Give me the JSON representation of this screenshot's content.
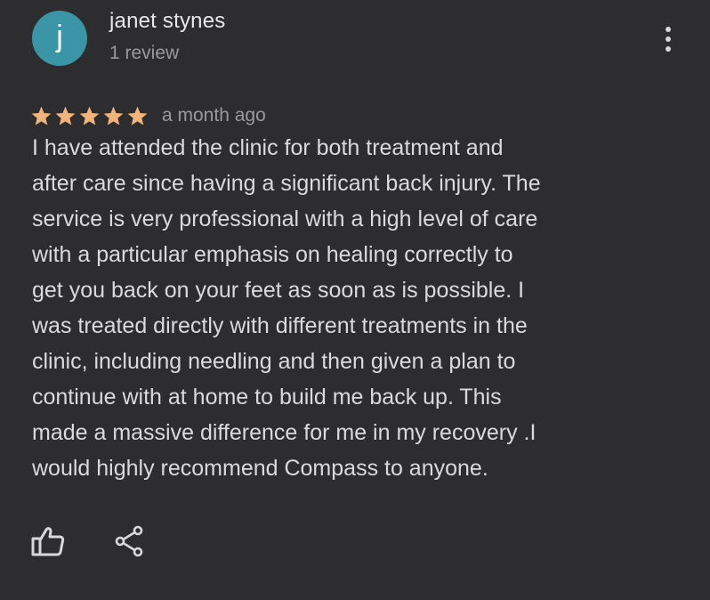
{
  "review": {
    "author": {
      "initial": "j",
      "name": "janet stynes",
      "review_count": "1 review",
      "avatar_color": "#3a95a6"
    },
    "rating": {
      "stars": 5,
      "max": 5,
      "star_color": "#f0b37a"
    },
    "date": "a month ago",
    "text": "I have attended the clinic for both treatment and\nafter care since having a significant back injury. The\nservice is very professional with  a high level of care\nwith a particular emphasis on healing correctly to\nget you back on your feet as soon as is possible. I\nwas treated directly with different treatments in the\nclinic, including needling and then given a plan to\ncontinue with at home to build me back up. This\nmade a massive difference for me in my recovery .I\nwould highly recommend Compass to anyone."
  },
  "actions": {
    "more_icon": "more-vertical-icon",
    "like_icon": "thumbs-up-icon",
    "share_icon": "share-icon"
  },
  "theme": {
    "background": "#2d2d30",
    "text": "#dadada",
    "secondary_text": "#9a9a9e"
  }
}
